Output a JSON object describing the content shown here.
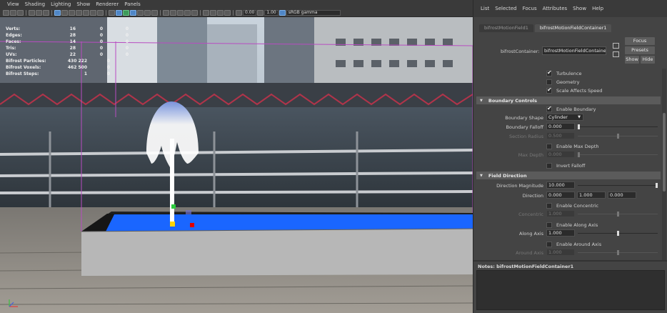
{
  "viewport": {
    "menu": [
      "View",
      "Shading",
      "Lighting",
      "Show",
      "Renderer",
      "Panels"
    ],
    "toolbar": {
      "exposure": "0.00",
      "gamma": "1.00",
      "colorspace": "sRGB gamma"
    },
    "hud": [
      {
        "key": "Verts:",
        "v1": "16",
        "v2": "0",
        "v3": "0"
      },
      {
        "key": "Edges:",
        "v1": "28",
        "v2": "0",
        "v3": "0"
      },
      {
        "key": "Faces:",
        "v1": "14",
        "v2": "0",
        "v3": "0"
      },
      {
        "key": "Tris:",
        "v1": "28",
        "v2": "0",
        "v3": "0"
      },
      {
        "key": "UVs:",
        "v1": "22",
        "v2": "0",
        "v3": "0"
      },
      {
        "key": "Bifrost Particles:",
        "v1": "430 222",
        "v2": "0",
        "v3": ""
      },
      {
        "key": "Bifrost Voxels:",
        "v1": "462 500",
        "v2": "0",
        "v3": ""
      },
      {
        "key": "Bifrost Steps:",
        "v1": "1",
        "v2": "0",
        "v3": ""
      }
    ]
  },
  "panel": {
    "menu": [
      "List",
      "Selected",
      "Focus",
      "Attributes",
      "Show",
      "Help"
    ],
    "tabs": [
      "bifrostMotionField1",
      "bifrostMotionFieldContainer1"
    ],
    "container_label": "bifrostContainer:",
    "container_value": "bifrostMotionFieldContainer1",
    "buttons": {
      "focus": "Focus",
      "presets": "Presets",
      "show": "Show",
      "hide": "Hide"
    },
    "checks_top": [
      {
        "label": "Turbulence",
        "on": true
      },
      {
        "label": "Geometry",
        "on": false
      },
      {
        "label": "Scale Affects Speed",
        "on": true
      }
    ],
    "boundary": {
      "header": "Boundary Controls",
      "enable_boundary": "Enable Boundary",
      "shape_label": "Boundary Shape",
      "shape_value": "Cylinder",
      "falloff_label": "Boundary Falloff",
      "falloff_value": "0.000",
      "falloff_level": 0.0,
      "section_radius_label": "Section Radius",
      "section_radius_value": "0.500",
      "section_radius_level": 0.5,
      "enable_max_depth": "Enable Max Depth",
      "max_depth_label": "Max Depth",
      "max_depth_value": "0.000",
      "max_depth_level": 0.0,
      "invert_falloff": "Invert Falloff"
    },
    "field_direction": {
      "header": "Field Direction",
      "magnitude_label": "Direction Magnitude",
      "magnitude_value": "10.000",
      "magnitude_level": 1.0,
      "direction_label": "Direction",
      "direction_x": "0.000",
      "direction_y": "1.000",
      "direction_z": "0.000",
      "enable_concentric": "Enable Concentric",
      "concentric_label": "Concentric",
      "concentric_value": "1.000",
      "concentric_level": 0.5,
      "enable_along_axis": "Enable Along Axis",
      "along_axis_label": "Along Axis",
      "along_axis_value": "1.000",
      "along_axis_level": 0.5,
      "enable_around_axis": "Enable Around Axis",
      "around_axis_label": "Around Axis",
      "around_axis_value": "1.000",
      "around_axis_level": 0.5
    },
    "notes_label": "Notes:  bifrostMotionFieldContainer1"
  }
}
